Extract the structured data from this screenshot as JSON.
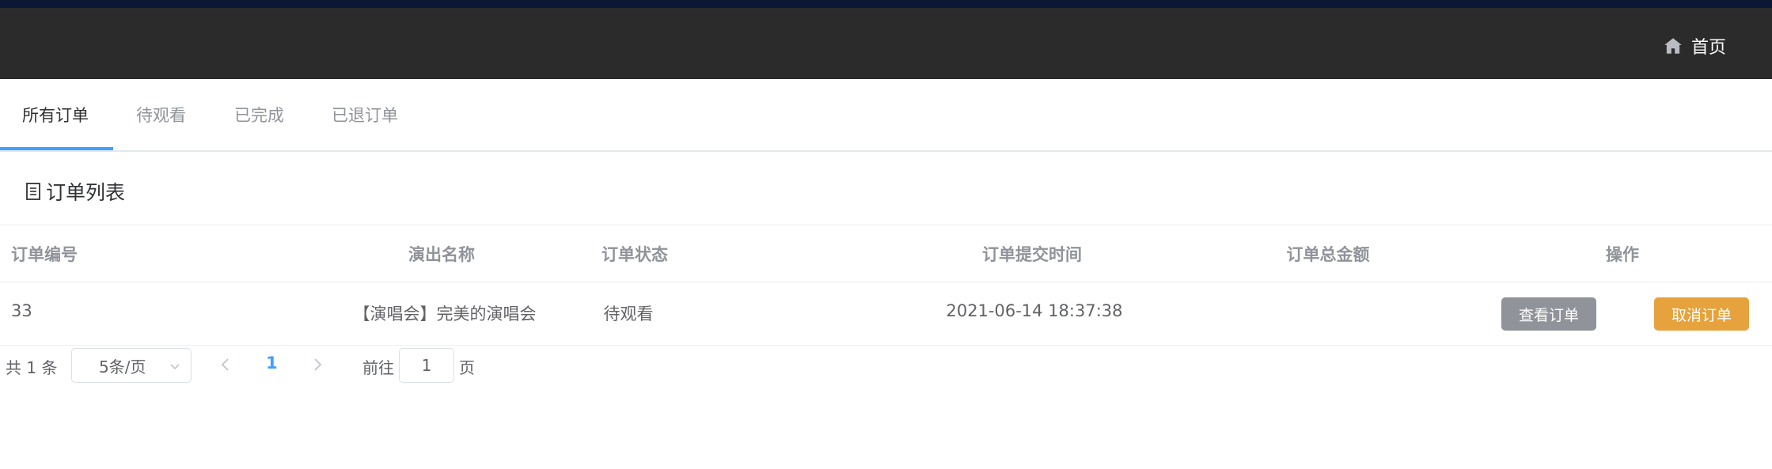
{
  "header": {
    "home_label": "首页",
    "home_icon": "home-icon"
  },
  "tabs": [
    {
      "label": "所有订单",
      "active": true
    },
    {
      "label": "待观看",
      "active": false
    },
    {
      "label": "已完成",
      "active": false
    },
    {
      "label": "已退订单",
      "active": false
    }
  ],
  "list_title": "订单列表",
  "table": {
    "columns": [
      "订单编号",
      "演出名称",
      "订单状态",
      "订单提交时间",
      "订单总金额",
      "操作"
    ],
    "rows": [
      {
        "order_id": "33",
        "show_name": "【演唱会】完美的演唱会",
        "status": "待观看",
        "submit_time": "2021-06-14 18:37:38",
        "total_amount": "",
        "actions": {
          "view": "查看订单",
          "cancel": "取消订单"
        }
      }
    ]
  },
  "pagination": {
    "total_text": "共 1 条",
    "page_size": "5条/页",
    "current_page": "1",
    "goto_label": "前往",
    "goto_value": "1",
    "goto_suffix": "页"
  },
  "colors": {
    "header_bg": "#2b2b2b",
    "accent": "#409eff",
    "view_button": "#909399",
    "cancel_button": "#e6a23c"
  }
}
